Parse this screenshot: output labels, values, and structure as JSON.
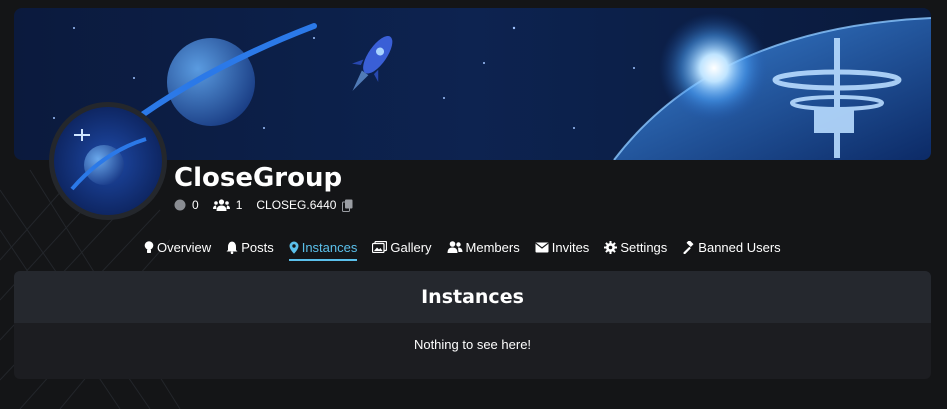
{
  "group": {
    "name": "CloseGroup",
    "online_count": "0",
    "member_count": "1",
    "code": "CLOSEG.6440"
  },
  "nav": {
    "items": [
      {
        "label": "Overview",
        "icon": "lightbulb-icon"
      },
      {
        "label": "Posts",
        "icon": "bell-icon"
      },
      {
        "label": "Instances",
        "icon": "map-pin-icon",
        "active": true
      },
      {
        "label": "Gallery",
        "icon": "images-icon"
      },
      {
        "label": "Members",
        "icon": "users-icon"
      },
      {
        "label": "Invites",
        "icon": "envelope-icon"
      },
      {
        "label": "Settings",
        "icon": "gear-icon"
      },
      {
        "label": "Banned Users",
        "icon": "gavel-icon"
      }
    ]
  },
  "panel": {
    "title": "Instances",
    "empty_message": "Nothing to see here!"
  },
  "colors": {
    "background": "#141517",
    "accent": "#5bc0eb",
    "panel": "#1c1d21",
    "panel_header": "#25282e"
  }
}
